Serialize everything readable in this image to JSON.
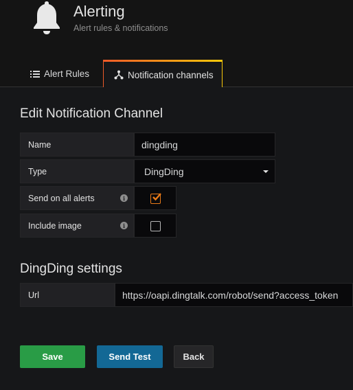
{
  "header": {
    "title": "Alerting",
    "subtitle": "Alert rules & notifications",
    "icon": "bell-icon"
  },
  "tabs": [
    {
      "label": "Alert Rules",
      "icon": "list-icon",
      "active": false
    },
    {
      "label": "Notification channels",
      "icon": "share-nodes-icon",
      "active": true
    }
  ],
  "form": {
    "title": "Edit Notification Channel",
    "name_label": "Name",
    "name_value": "dingding",
    "type_label": "Type",
    "type_value": "DingDing",
    "send_all_label": "Send on all alerts",
    "send_all_checked": true,
    "include_image_label": "Include image",
    "include_image_checked": false
  },
  "settings": {
    "title": "DingDing settings",
    "url_label": "Url",
    "url_value": "https://oapi.dingtalk.com/robot/send?access_token"
  },
  "buttons": {
    "save": "Save",
    "send_test": "Send Test",
    "back": "Back"
  },
  "colors": {
    "save": "#299c46",
    "send_test": "#136895",
    "checkbox_accent": "#eb7b18",
    "tab_accent": "#f05a28"
  }
}
